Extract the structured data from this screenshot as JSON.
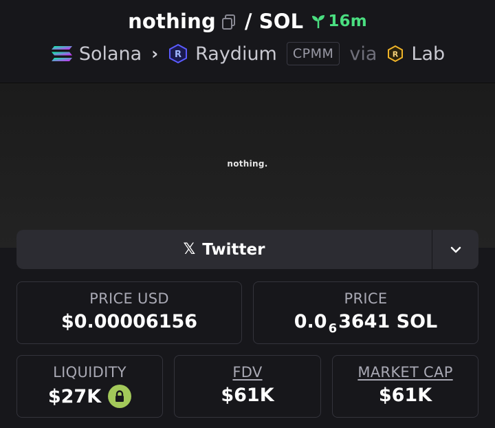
{
  "header": {
    "token_name": "nothing",
    "separator": "/",
    "quote_token": "SOL",
    "age": "16m",
    "chain": "Solana",
    "dex": "Raydium",
    "pool_type": "CPMM",
    "via_label": "via",
    "launchpad": "Lab"
  },
  "banner": {
    "text": "nothing."
  },
  "social": {
    "twitter_label": "Twitter"
  },
  "stats": {
    "price_usd_label": "PRICE USD",
    "price_usd_value": "$0.00006156",
    "price_label": "PRICE",
    "price_prefix": "0.0",
    "price_subscript": "6",
    "price_suffix": "3641 SOL",
    "liquidity_label": "LIQUIDITY",
    "liquidity_value": "$27K",
    "fdv_label": "FDV",
    "fdv_value": "$61K",
    "mcap_label": "MARKET CAP",
    "mcap_value": "$61K"
  },
  "colors": {
    "background": "#17171b",
    "accent_green": "#4ade80",
    "lock_green": "#a3c95a",
    "card_border": "#34343c"
  }
}
